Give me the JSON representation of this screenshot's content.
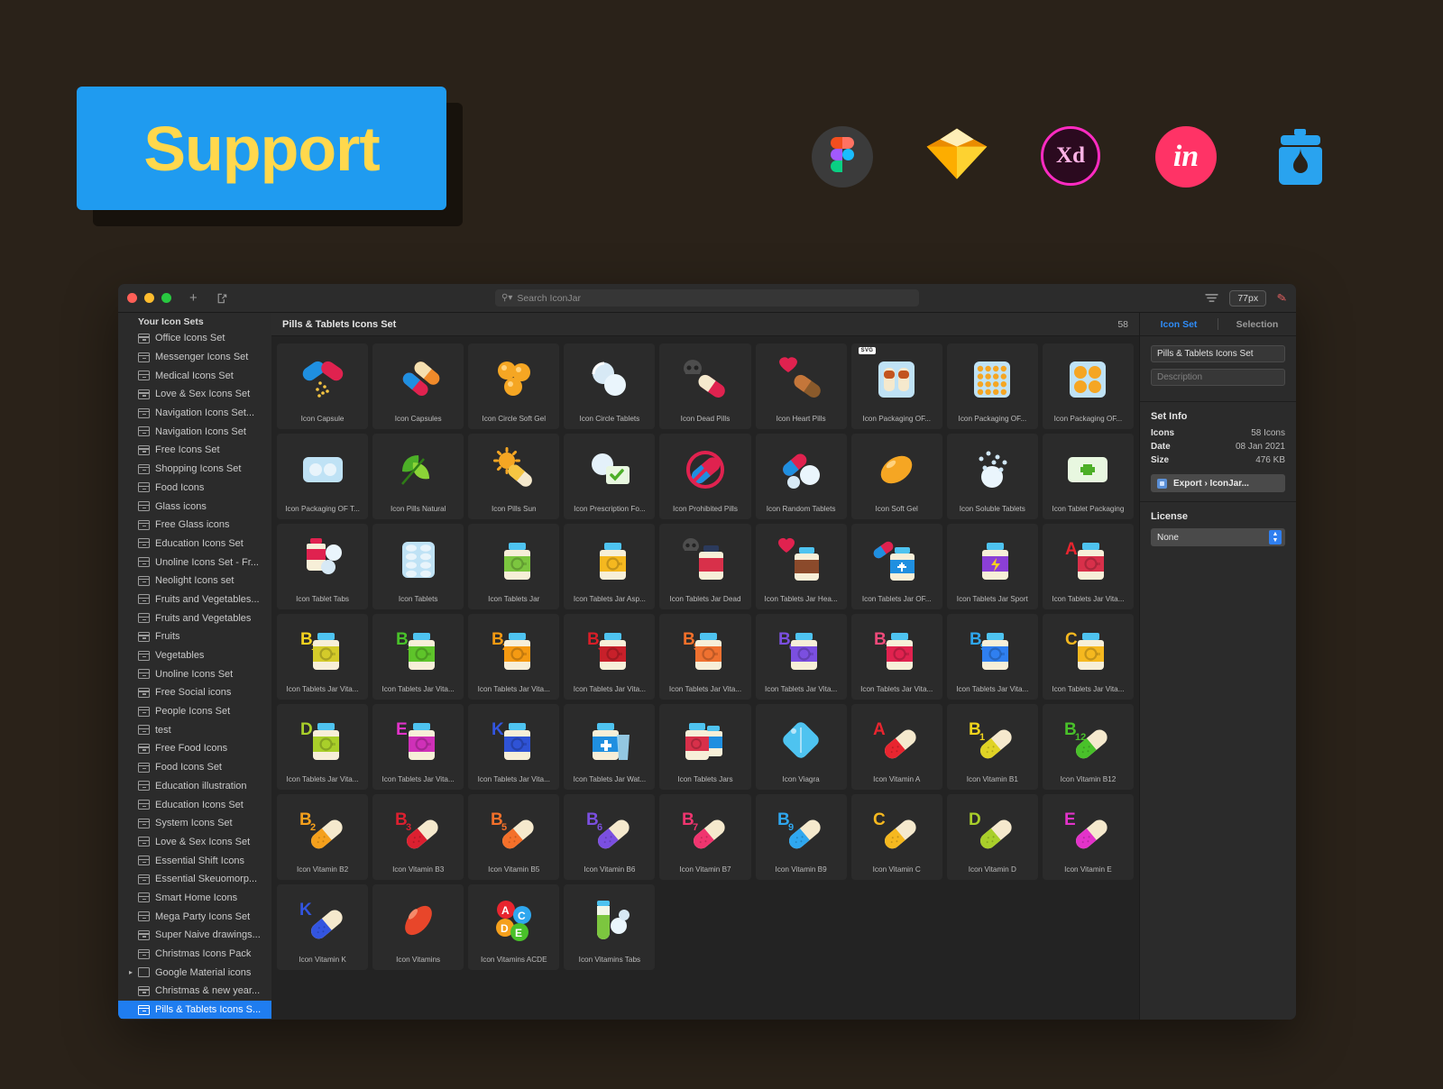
{
  "promo": {
    "support_label": "Support",
    "logos": [
      {
        "name": "figma-logo",
        "label": "Figma"
      },
      {
        "name": "sketch-logo",
        "label": "Sketch"
      },
      {
        "name": "adobe-xd-logo",
        "label": "Xd"
      },
      {
        "name": "invision-logo",
        "label": "in"
      },
      {
        "name": "iconjar-logo",
        "label": "IconJar"
      }
    ],
    "colors": {
      "support_bg": "#1f9bf0",
      "support_text": "#ffd84d",
      "page_bg": "#2a2219"
    }
  },
  "window": {
    "traffic_lights": [
      "close",
      "minimize",
      "zoom"
    ],
    "toolbar": {
      "add_label": "+",
      "export_label": "export-icon",
      "search_placeholder": "Search IconJar",
      "filter_label": "filter-icon",
      "zoom_value": "77px",
      "edit_label": "pencil-icon"
    }
  },
  "sidebar": {
    "title": "Your Icon Sets",
    "items": [
      {
        "label": "Office Icons Set",
        "type": "set"
      },
      {
        "label": "Messenger Icons Set",
        "type": "set"
      },
      {
        "label": "Medical Icons Set",
        "type": "set"
      },
      {
        "label": "Love & Sex Icons Set",
        "type": "set"
      },
      {
        "label": "Navigation Icons Set...",
        "type": "set"
      },
      {
        "label": "Navigation Icons Set",
        "type": "set"
      },
      {
        "label": "Free Icons Set",
        "type": "set"
      },
      {
        "label": "Shopping Icons Set",
        "type": "set"
      },
      {
        "label": "Food Icons",
        "type": "set"
      },
      {
        "label": "Glass icons",
        "type": "set"
      },
      {
        "label": "Free Glass icons",
        "type": "set"
      },
      {
        "label": "Education Icons Set",
        "type": "set"
      },
      {
        "label": "Unoline Icons Set - Fr...",
        "type": "set"
      },
      {
        "label": "Neolight Icons set",
        "type": "set"
      },
      {
        "label": "Fruits and Vegetables...",
        "type": "set"
      },
      {
        "label": "Fruits and Vegetables",
        "type": "set"
      },
      {
        "label": "Fruits",
        "type": "set"
      },
      {
        "label": "Vegetables",
        "type": "set"
      },
      {
        "label": "Unoline Icons Set",
        "type": "set"
      },
      {
        "label": "Free Social icons",
        "type": "set"
      },
      {
        "label": "People Icons Set",
        "type": "set"
      },
      {
        "label": "test",
        "type": "set"
      },
      {
        "label": "Free Food Icons",
        "type": "set"
      },
      {
        "label": "Food Icons Set",
        "type": "set"
      },
      {
        "label": "Education illustration",
        "type": "set"
      },
      {
        "label": "Education Icons Set",
        "type": "set"
      },
      {
        "label": "System Icons Set",
        "type": "set"
      },
      {
        "label": "Love & Sex Icons Set",
        "type": "set"
      },
      {
        "label": "Essential Shift Icons",
        "type": "set"
      },
      {
        "label": "Essential Skeuomorp...",
        "type": "set"
      },
      {
        "label": "Smart Home Icons",
        "type": "set"
      },
      {
        "label": "Mega Party Icons Set",
        "type": "set"
      },
      {
        "label": "Super Naive drawings...",
        "type": "set"
      },
      {
        "label": "Christmas Icons Pack",
        "type": "set"
      },
      {
        "label": "Google Material icons",
        "type": "folder"
      },
      {
        "label": "Christmas & new year...",
        "type": "set"
      },
      {
        "label": "Pills & Tablets Icons S...",
        "type": "set",
        "selected": true
      }
    ]
  },
  "main": {
    "title": "Pills & Tablets Icons Set",
    "count": "58",
    "icons": [
      {
        "label": "Icon Capsule",
        "art": "capsule"
      },
      {
        "label": "Icon Capsules",
        "art": "capsules"
      },
      {
        "label": "Icon Circle Soft Gel",
        "art": "circlesoftgel"
      },
      {
        "label": "Icon Circle Tablets",
        "art": "circletablets"
      },
      {
        "label": "Icon Dead Pills",
        "art": "deadpills"
      },
      {
        "label": "Icon Heart Pills",
        "art": "heartpills"
      },
      {
        "label": "Icon Packaging OF...",
        "art": "packaging1",
        "badge": "SVG"
      },
      {
        "label": "Icon Packaging OF...",
        "art": "packaging2"
      },
      {
        "label": "Icon Packaging OF...",
        "art": "packaging3"
      },
      {
        "label": "Icon Packaging OF T...",
        "art": "packaging4"
      },
      {
        "label": "Icon Pills Natural",
        "art": "pillsnatural"
      },
      {
        "label": "Icon Pills Sun",
        "art": "pillssun"
      },
      {
        "label": "Icon Prescription Fo...",
        "art": "prescription"
      },
      {
        "label": "Icon Prohibited Pills",
        "art": "prohibited"
      },
      {
        "label": "Icon Random Tablets",
        "art": "randomtablets"
      },
      {
        "label": "Icon Soft Gel",
        "art": "softgel"
      },
      {
        "label": "Icon Soluble Tablets",
        "art": "soluble"
      },
      {
        "label": "Icon Tablet Packaging",
        "art": "tabletpackaging"
      },
      {
        "label": "Icon Tablet Tabs",
        "art": "tablettabs"
      },
      {
        "label": "Icon Tablets",
        "art": "tablets"
      },
      {
        "label": "Icon Tablets Jar",
        "art": "jargreen"
      },
      {
        "label": "Icon Tablets Jar Asp...",
        "art": "jaryellow"
      },
      {
        "label": "Icon Tablets Jar Dead",
        "art": "jardead"
      },
      {
        "label": "Icon Tablets Jar Hea...",
        "art": "jarheart"
      },
      {
        "label": "Icon Tablets Jar OF...",
        "art": "jarof"
      },
      {
        "label": "Icon Tablets Jar Sport",
        "art": "jarsport"
      },
      {
        "label": "Icon Tablets Jar Vita...",
        "art": "jarvitaA"
      },
      {
        "label": "Icon Tablets Jar Vita...",
        "art": "jarB1",
        "letter": "B",
        "sub": "1",
        "color": "#f5d21f"
      },
      {
        "label": "Icon Tablets Jar Vita...",
        "art": "jarB12",
        "letter": "B",
        "sub": "12",
        "color": "#49c12a"
      },
      {
        "label": "Icon Tablets Jar Vita...",
        "art": "jarB2",
        "letter": "B",
        "sub": "2",
        "color": "#f59a12"
      },
      {
        "label": "Icon Tablets Jar Vita...",
        "art": "jarB3",
        "letter": "B",
        "sub": "3",
        "color": "#d91e28"
      },
      {
        "label": "Icon Tablets Jar Vita...",
        "art": "jarB5",
        "letter": "B",
        "sub": "5",
        "color": "#f4702a"
      },
      {
        "label": "Icon Tablets Jar Vita...",
        "art": "jarB6",
        "letter": "B",
        "sub": "6",
        "color": "#7b4fe0"
      },
      {
        "label": "Icon Tablets Jar Vita...",
        "art": "jarB7",
        "letter": "B",
        "sub": "7",
        "color": "#f04a7a"
      },
      {
        "label": "Icon Tablets Jar Vita...",
        "art": "jarB9",
        "letter": "B",
        "sub": "9",
        "color": "#2fa7ef"
      },
      {
        "label": "Icon Tablets Jar Vita...",
        "art": "jarC",
        "letter": "C",
        "sub": "",
        "color": "#f5b81f"
      },
      {
        "label": "Icon Tablets Jar Vita...",
        "art": "jarD",
        "letter": "D",
        "sub": "",
        "color": "#a9cf2a"
      },
      {
        "label": "Icon Tablets Jar Vita...",
        "art": "jarE",
        "letter": "E",
        "sub": "",
        "color": "#e233c9"
      },
      {
        "label": "Icon Tablets Jar Vita...",
        "art": "jarK",
        "letter": "K",
        "sub": "",
        "color": "#3355e0"
      },
      {
        "label": "Icon Tablets Jar Wat...",
        "art": "jarwater"
      },
      {
        "label": "Icon Tablets Jars",
        "art": "jars"
      },
      {
        "label": "Icon Viagra",
        "art": "viagra"
      },
      {
        "label": "Icon Vitamin A",
        "art": "vitA",
        "letter": "A",
        "sub": "",
        "color": "#e8252f"
      },
      {
        "label": "Icon Vitamin B1",
        "art": "vitB1",
        "letter": "B",
        "sub": "1",
        "color": "#f0d41c"
      },
      {
        "label": "Icon Vitamin B12",
        "art": "vitB12",
        "letter": "B",
        "sub": "12",
        "color": "#49c12a"
      },
      {
        "label": "Icon Vitamin B2",
        "art": "vitB2",
        "letter": "B",
        "sub": "2",
        "color": "#f5a01c"
      },
      {
        "label": "Icon Vitamin B3",
        "art": "vitB3",
        "letter": "B",
        "sub": "3",
        "color": "#dc2030"
      },
      {
        "label": "Icon Vitamin B5",
        "art": "vitB5",
        "letter": "B",
        "sub": "5",
        "color": "#f4702a"
      },
      {
        "label": "Icon Vitamin B6",
        "art": "vitB6",
        "letter": "B",
        "sub": "6",
        "color": "#7b4fe0"
      },
      {
        "label": "Icon Vitamin B7",
        "art": "vitB7",
        "letter": "B",
        "sub": "7",
        "color": "#f0356f"
      },
      {
        "label": "Icon Vitamin B9",
        "art": "vitB9",
        "letter": "B",
        "sub": "9",
        "color": "#2fa7ef"
      },
      {
        "label": "Icon Vitamin C",
        "art": "vitC",
        "letter": "C",
        "sub": "",
        "color": "#f5b81f"
      },
      {
        "label": "Icon Vitamin D",
        "art": "vitD",
        "letter": "D",
        "sub": "",
        "color": "#a9cf2a"
      },
      {
        "label": "Icon Vitamin E",
        "art": "vitE",
        "letter": "E",
        "sub": "",
        "color": "#e233c9"
      },
      {
        "label": "Icon Vitamin K",
        "art": "vitK",
        "letter": "K",
        "sub": "",
        "color": "#3355e0"
      },
      {
        "label": "Icon Vitamins",
        "art": "vitamins"
      },
      {
        "label": "Icon Vitamins ACDE",
        "art": "vitaminsacde"
      },
      {
        "label": "Icon Vitamins Tabs",
        "art": "vitaminstabs"
      }
    ]
  },
  "inspector": {
    "tabs": [
      {
        "label": "Icon Set",
        "active": true
      },
      {
        "label": "Selection",
        "active": false
      }
    ],
    "name_value": "Pills & Tablets Icons Set",
    "description_placeholder": "Description",
    "set_info_title": "Set Info",
    "rows": [
      {
        "key": "Icons",
        "value": "58 Icons"
      },
      {
        "key": "Date",
        "value": "08 Jan 2021"
      },
      {
        "key": "Size",
        "value": "476 KB"
      }
    ],
    "export_label": "Export › IconJar...",
    "license_title": "License",
    "license_value": "None"
  }
}
